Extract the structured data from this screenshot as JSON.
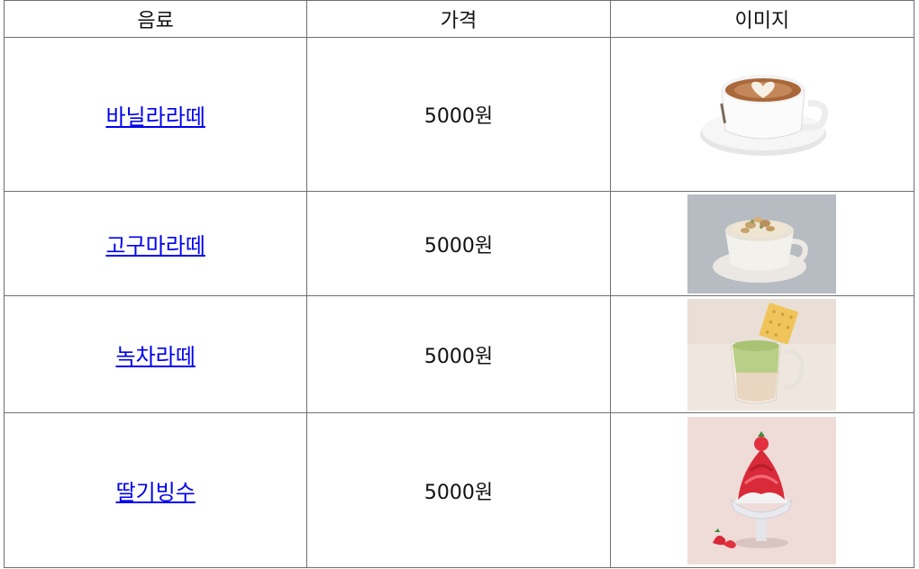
{
  "table": {
    "headers": [
      "음료",
      "가격",
      "이미지"
    ],
    "rows": [
      {
        "name": "바닐라라떼",
        "price": "5000원",
        "image": "cafe-latte-heart-art"
      },
      {
        "name": "고구마라떼",
        "price": "5000원",
        "image": "sweet-potato-latte"
      },
      {
        "name": "녹차라떼",
        "price": "5000원",
        "image": "green-tea-latte"
      },
      {
        "name": "딸기빙수",
        "price": "5000원",
        "image": "strawberry-bingsu"
      }
    ]
  },
  "colors": {
    "link": "#0000ee",
    "border": "#6f6f6f"
  }
}
